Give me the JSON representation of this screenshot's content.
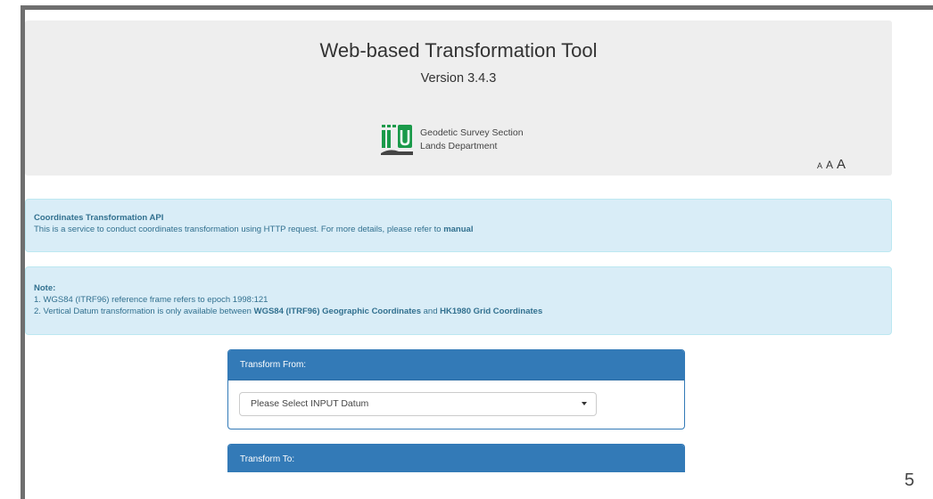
{
  "header": {
    "title": "Web-based Transformation Tool",
    "version": "Version 3.4.3",
    "org_line1": "Geodetic Survey Section",
    "org_line2": "Lands Department",
    "logo_icon": "lands-department-logo",
    "font_size_controls": [
      "A",
      "A",
      "A"
    ]
  },
  "api_panel": {
    "title": "Coordinates Transformation API",
    "text": "This is a service to conduct coordinates transformation using HTTP request. For more details, please refer to",
    "link": "manual"
  },
  "note_panel": {
    "title": "Note:",
    "line1": "1. WGS84 (ITRF96) reference frame refers to epoch 1998:121",
    "line2_prefix": "2. Vertical Datum transformation is only available between",
    "line2_bold1": "WGS84 (ITRF96) Geographic Coordinates",
    "line2_mid": "and",
    "line2_bold2": "HK1980 Grid Coordinates"
  },
  "transform_from": {
    "heading": "Transform From:",
    "select_value": "Please Select INPUT Datum"
  },
  "transform_to": {
    "heading": "Transform To:"
  },
  "slide": {
    "page_number": "5"
  },
  "colors": {
    "primary": "#337ab7",
    "info_bg": "#d9edf7",
    "info_text": "#31708f",
    "header_bg": "#eeeeee",
    "logo_green": "#1a9a4a"
  }
}
